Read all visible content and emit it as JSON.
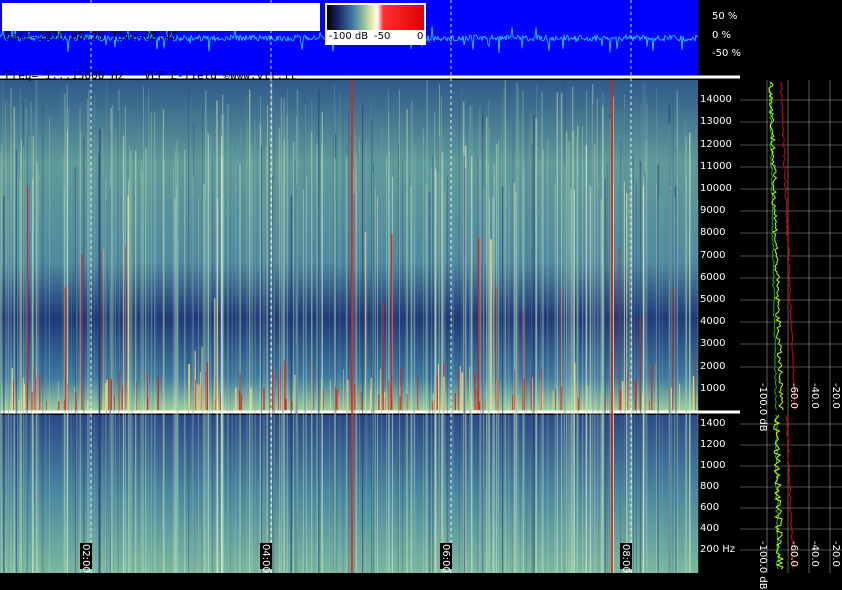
{
  "header": {
    "date_line": "Date=2026-08-20 Time=08:45",
    "freq_line": "Freq= 1...15000 Hz   VLF E-field ©www.vlf.it"
  },
  "colorbar": {
    "labels": [
      "-100 dB",
      "-50",
      "0"
    ],
    "stops": [
      "#000000",
      "#1a2a6a",
      "#3b6fa0",
      "#8fbfa0",
      "#e8e8a0",
      "#ffffff",
      "#ff3030",
      "#e00000"
    ]
  },
  "waveform": {
    "labels": [
      "50 %",
      "0 %",
      "-50 %"
    ],
    "background": "#0000ff",
    "trace_color": "#20e0ff"
  },
  "chart_data": [
    {
      "type": "heatmap",
      "title": "",
      "yunit": "Hz",
      "ylim": [
        0,
        15000
      ],
      "yticks": [
        1000,
        2000,
        3000,
        4000,
        5000,
        6000,
        7000,
        8000,
        9000,
        10000,
        11000,
        12000,
        13000,
        14000
      ],
      "ytick_labels": [
        "1000",
        "2000",
        "3000",
        "4000",
        "5000",
        "6000",
        "7000",
        "8000",
        "9000",
        "10000",
        "11000",
        "12000",
        "13000",
        "14000"
      ],
      "time_ticks": [
        "02:00",
        "04:00",
        "06:00",
        "08:00"
      ]
    },
    {
      "type": "heatmap",
      "title": "",
      "yunit": "Hz",
      "ylim": [
        0,
        1500
      ],
      "yticks": [
        200,
        400,
        600,
        800,
        1000,
        1200,
        1400
      ],
      "ytick_labels": [
        "200 Hz",
        "400",
        "600",
        "800",
        "1000",
        "1200",
        "1400"
      ],
      "time_ticks": [
        "02:00",
        "04:00",
        "06:00",
        "08:00"
      ]
    },
    {
      "type": "line",
      "xunit": "dB",
      "xticks": [
        "-100.0 dB",
        "-60.0",
        "-40.0",
        "-20.0"
      ],
      "series": [
        {
          "color": "#c8ff00"
        },
        {
          "color": "#00c000"
        },
        {
          "color": "#e00000"
        }
      ]
    }
  ]
}
